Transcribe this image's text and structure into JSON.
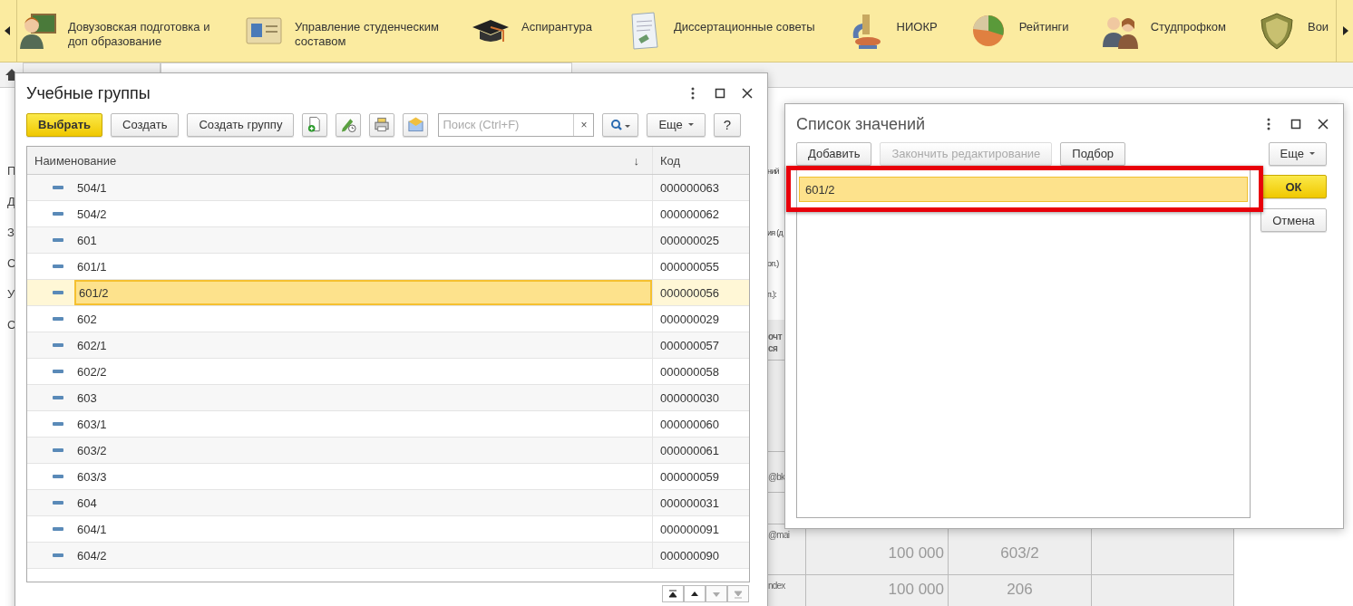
{
  "sections_bar": {
    "sections": [
      {
        "label": "Довузовская подготовка и доп образование",
        "kind": "teacher"
      },
      {
        "label": "Управление студенческим составом",
        "kind": "id-card"
      },
      {
        "label": "Аспирантура",
        "kind": "cap"
      },
      {
        "label": "Диссертационные советы",
        "kind": "document"
      },
      {
        "label": "НИОКР",
        "kind": "microscope"
      },
      {
        "label": "Рейтинги",
        "kind": "pie"
      },
      {
        "label": "Студпрофком",
        "kind": "people"
      },
      {
        "label": "Вои",
        "kind": "shield"
      }
    ]
  },
  "background_form": {
    "left_labels": [
      "П",
      "Д",
      "З",
      "С",
      "У",
      "С"
    ],
    "right_labels": [
      "ний",
      "ия (д",
      "оп.)",
      "п.):"
    ],
    "table": {
      "header": "очт ся",
      "rows": [
        {
          "column_1": "",
          "column_2": "",
          "column_3": ""
        },
        {
          "column_1": "@bk",
          "column_2": "",
          "column_3": ""
        },
        {
          "column_1": "",
          "column_2": "",
          "column_3": ""
        },
        {
          "column_1": "@mai",
          "column_2": "100 000",
          "column_3": "603/2"
        },
        {
          "column_1": "ndex",
          "column_2": "100 000",
          "column_3": "206"
        }
      ]
    }
  },
  "groups_dialog": {
    "title": "Учебные группы",
    "buttons": [
      {
        "label": "Выбрать",
        "default": true
      },
      {
        "label": "Создать",
        "default": false
      },
      {
        "label": "Создать группу",
        "default": false
      }
    ],
    "icon_tools": [
      {
        "kind": "add-document"
      },
      {
        "kind": "edit-history"
      },
      {
        "kind": "print"
      },
      {
        "kind": "mail"
      }
    ],
    "search": {
      "placeholder": "Поиск (Ctrl+F)",
      "clear": "×"
    },
    "more_menu": "Еще",
    "help": "?",
    "table": {
      "columns": [
        {
          "label": "Наименование",
          "sort_mark": "↓"
        },
        {
          "label": "Код"
        }
      ],
      "rows": [
        {
          "name": "504/1",
          "code": "000000063",
          "selected": false
        },
        {
          "name": "504/2",
          "code": "000000062",
          "selected": false
        },
        {
          "name": "601",
          "code": "000000025",
          "selected": false
        },
        {
          "name": "601/1",
          "code": "000000055",
          "selected": false
        },
        {
          "name": "601/2",
          "code": "000000056",
          "selected": true
        },
        {
          "name": "602",
          "code": "000000029",
          "selected": false
        },
        {
          "name": "602/1",
          "code": "000000057",
          "selected": false
        },
        {
          "name": "602/2",
          "code": "000000058",
          "selected": false
        },
        {
          "name": "603",
          "code": "000000030",
          "selected": false
        },
        {
          "name": "603/1",
          "code": "000000060",
          "selected": false
        },
        {
          "name": "603/2",
          "code": "000000061",
          "selected": false
        },
        {
          "name": "603/3",
          "code": "000000059",
          "selected": false
        },
        {
          "name": "604",
          "code": "000000031",
          "selected": false
        },
        {
          "name": "604/1",
          "code": "000000091",
          "selected": false
        },
        {
          "name": "604/2",
          "code": "000000090",
          "selected": false
        }
      ]
    },
    "nav_buttons": [
      {
        "kind": "first",
        "disabled": false
      },
      {
        "kind": "up",
        "disabled": false
      },
      {
        "kind": "down",
        "disabled": true
      },
      {
        "kind": "last",
        "disabled": true
      }
    ]
  },
  "values_dialog": {
    "title": "Список значений",
    "buttons": [
      {
        "label": "Добавить",
        "disabled": false
      },
      {
        "label": "Закончить редактирование",
        "disabled": true
      },
      {
        "label": "Подбор",
        "disabled": false
      }
    ],
    "more_menu": "Еще",
    "items": [
      {
        "value": "601/2",
        "selected": true
      }
    ],
    "highlighted": true,
    "ok": "ОК",
    "cancel": "Отмена"
  }
}
